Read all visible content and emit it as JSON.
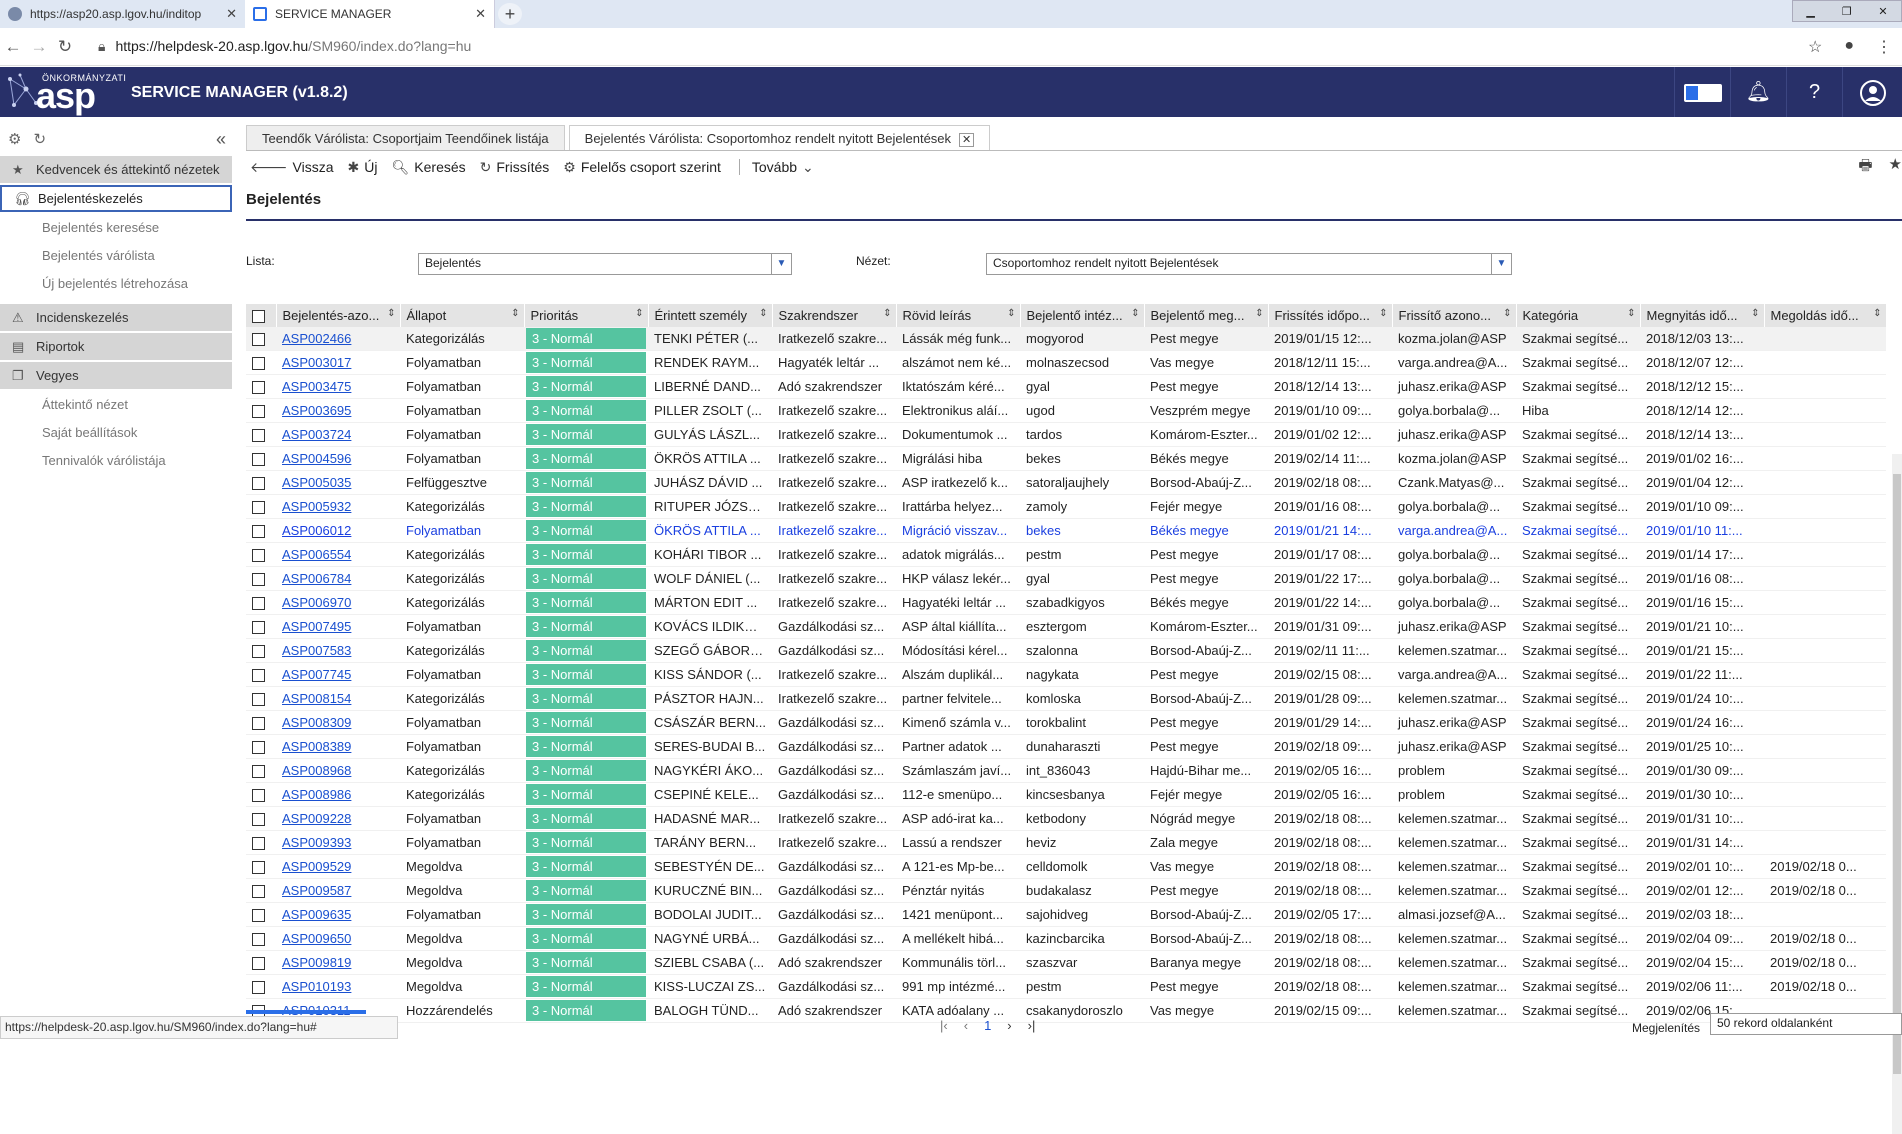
{
  "browser": {
    "tabs": [
      {
        "label": "https://asp20.asp.lgov.hu/inditop"
      },
      {
        "label": "SERVICE MANAGER"
      }
    ],
    "url_host": "https://helpdesk-20.asp.lgov.hu",
    "url_path": "/SM960/index.do?lang=hu"
  },
  "header": {
    "logo_small": "ÖNKORMÁNYZATI",
    "logo_big": "asp",
    "title": "SERVICE MANAGER (v1.8.2)"
  },
  "sidebar": {
    "sections": [
      {
        "label": "Kedvencek és áttekintő nézetek",
        "icon": "star-icon",
        "items": []
      },
      {
        "label": "Bejelentéskezelés",
        "icon": "headset-icon",
        "active": true,
        "items": [
          "Bejelentés keresése",
          "Bejelentés várólista",
          "Új bejelentés létrehozása"
        ]
      },
      {
        "label": "Incidenskezelés",
        "icon": "warning-icon",
        "items": []
      },
      {
        "label": "Riportok",
        "icon": "report-icon",
        "items": []
      },
      {
        "label": "Vegyes",
        "icon": "copy-icon",
        "items": [
          "Áttekintő nézet",
          "Saját beállítások",
          "Tennivalók várólistája"
        ]
      }
    ]
  },
  "content_tabs": [
    {
      "label": "Teendők Várólista: Csoportjaim Teendőinek listája"
    },
    {
      "label": "Bejelentés Várólista: Csoportomhoz rendelt nyitott Bejelentések"
    }
  ],
  "toolbar": {
    "back": "Vissza",
    "new": "Új",
    "search": "Keresés",
    "refresh": "Frissítés",
    "group_by": "Felelős csoport szerint",
    "more": "Tovább"
  },
  "page_title": "Bejelentés",
  "filters": {
    "list_label": "Lista:",
    "list_value": "Bejelentés",
    "view_label": "Nézet:",
    "view_value": "Csoportomhoz rendelt nyitott Bejelentések"
  },
  "table": {
    "columns": [
      "Bejelentés-azo...",
      "Állapot",
      "Prioritás",
      "Érintett személy",
      "Szakrendszer",
      "Rövid leírás",
      "Bejelentő intéz...",
      "Bejelentő meg...",
      "Frissítés időpo...",
      "Frissítő azono...",
      "Kategória",
      "Megnyitás idő...",
      "Megoldás idő..."
    ],
    "rows": [
      [
        "ASP002466",
        "Kategorizálás",
        "3 - Normál",
        "TENKI PÉTER (...",
        "Iratkezelő szakre...",
        "Lássák még funk...",
        "mogyorod",
        "Pest megye",
        "2019/01/15 12:...",
        "kozma.jolan@ASP",
        "Szakmai segítsé...",
        "2018/12/03 13:...",
        ""
      ],
      [
        "ASP003017",
        "Folyamatban",
        "3 - Normál",
        "RENDEK RAYM...",
        "Hagyaték leltár ...",
        "alszámot nem ké...",
        "molnaszecsod",
        "Vas megye",
        "2018/12/11 15:...",
        "varga.andrea@A...",
        "Szakmai segítsé...",
        "2018/12/07 12:...",
        ""
      ],
      [
        "ASP003475",
        "Folyamatban",
        "3 - Normál",
        "LIBERNÉ DAND...",
        "Adó szakrendszer",
        "Iktatószám kéré...",
        "gyal",
        "Pest megye",
        "2018/12/14 13:...",
        "juhasz.erika@ASP",
        "Szakmai segítsé...",
        "2018/12/12 15:...",
        ""
      ],
      [
        "ASP003695",
        "Folyamatban",
        "3 - Normál",
        "PILLER ZSOLT (...",
        "Iratkezelő szakre...",
        "Elektronikus aláí...",
        "ugod",
        "Veszprém megye",
        "2019/01/10 09:...",
        "golya.borbala@...",
        "Hiba",
        "2018/12/14 12:...",
        ""
      ],
      [
        "ASP003724",
        "Folyamatban",
        "3 - Normál",
        "GULYÁS LÁSZL...",
        "Iratkezelő szakre...",
        "Dokumentumok ...",
        "tardos",
        "Komárom-Eszter...",
        "2019/01/02 12:...",
        "juhasz.erika@ASP",
        "Szakmai segítsé...",
        "2018/12/14 13:...",
        ""
      ],
      [
        "ASP004596",
        "Folyamatban",
        "3 - Normál",
        "ÖKRÖS ATTILA ...",
        "Iratkezelő szakre...",
        "Migrálási hiba",
        "bekes",
        "Békés megye",
        "2019/02/14 11:...",
        "kozma.jolan@ASP",
        "Szakmai segítsé...",
        "2019/01/02 16:...",
        ""
      ],
      [
        "ASP005035",
        "Felfüggesztve",
        "3 - Normál",
        "JUHÁSZ DÁVID ...",
        "Iratkezelő szakre...",
        "ASP iratkezelő k...",
        "satoraljaujhely",
        "Borsod-Abaúj-Z...",
        "2019/02/18 08:...",
        "Czank.Matyas@...",
        "Szakmai segítsé...",
        "2019/01/04 12:...",
        ""
      ],
      [
        "ASP005932",
        "Kategorizálás",
        "3 - Normál",
        "RITUPER JÓZSE...",
        "Iratkezelő szakre...",
        "Irattárba helyez...",
        "zamoly",
        "Fejér megye",
        "2019/01/16 08:...",
        "golya.borbala@...",
        "Szakmai segítsé...",
        "2019/01/10 09:...",
        ""
      ],
      [
        "ASP006012",
        "Folyamatban",
        "3 - Normál",
        "ÖKRÖS ATTILA ...",
        "Iratkezelő szakre...",
        "Migráció visszav...",
        "bekes",
        "Békés megye",
        "2019/01/21 14:...",
        "varga.andrea@A...",
        "Szakmai segítsé...",
        "2019/01/10 11:...",
        ""
      ],
      [
        "ASP006554",
        "Kategorizálás",
        "3 - Normál",
        "KOHÁRI TIBOR ...",
        "Iratkezelő szakre...",
        "adatok migrálás...",
        "pestm",
        "Pest megye",
        "2019/01/17 08:...",
        "golya.borbala@...",
        "Szakmai segítsé...",
        "2019/01/14 17:...",
        ""
      ],
      [
        "ASP006784",
        "Kategorizálás",
        "3 - Normál",
        "WOLF DÁNIEL (...",
        "Iratkezelő szakre...",
        "HKP válasz lekér...",
        "gyal",
        "Pest megye",
        "2019/01/22 17:...",
        "golya.borbala@...",
        "Szakmai segítsé...",
        "2019/01/16 08:...",
        ""
      ],
      [
        "ASP006970",
        "Kategorizálás",
        "3 - Normál",
        "MÁRTON EDIT ...",
        "Iratkezelő szakre...",
        "Hagyatéki leltár ...",
        "szabadkigyos",
        "Békés megye",
        "2019/01/22 14:...",
        "golya.borbala@...",
        "Szakmai segítsé...",
        "2019/01/16 15:...",
        ""
      ],
      [
        "ASP007495",
        "Folyamatban",
        "3 - Normál",
        "KOVÁCS ILDIKÓ ...",
        "Gazdálkodási sz...",
        "ASP által kiállíta...",
        "esztergom",
        "Komárom-Eszter...",
        "2019/01/31 09:...",
        "juhasz.erika@ASP",
        "Szakmai segítsé...",
        "2019/01/21 10:...",
        ""
      ],
      [
        "ASP007583",
        "Kategorizálás",
        "3 - Normál",
        "SZEGŐ GÁBOR (...",
        "Gazdálkodási sz...",
        "Módosítási kérel...",
        "szalonna",
        "Borsod-Abaúj-Z...",
        "2019/02/11 11:...",
        "kelemen.szatmar...",
        "Szakmai segítsé...",
        "2019/01/21 15:...",
        ""
      ],
      [
        "ASP007745",
        "Folyamatban",
        "3 - Normál",
        "KISS SÁNDOR (...",
        "Iratkezelő szakre...",
        "Alszám duplikál...",
        "nagykata",
        "Pest megye",
        "2019/02/15 08:...",
        "varga.andrea@A...",
        "Szakmai segítsé...",
        "2019/01/22 11:...",
        ""
      ],
      [
        "ASP008154",
        "Kategorizálás",
        "3 - Normál",
        "PÁSZTOR HAJN...",
        "Iratkezelő szakre...",
        "partner felvitele...",
        "komloska",
        "Borsod-Abaúj-Z...",
        "2019/01/28 09:...",
        "kelemen.szatmar...",
        "Szakmai segítsé...",
        "2019/01/24 10:...",
        ""
      ],
      [
        "ASP008309",
        "Folyamatban",
        "3 - Normál",
        "CSÁSZÁR BERN...",
        "Gazdálkodási sz...",
        "Kimenő számla v...",
        "torokbalint",
        "Pest megye",
        "2019/01/29 14:...",
        "juhasz.erika@ASP",
        "Szakmai segítsé...",
        "2019/01/24 16:...",
        ""
      ],
      [
        "ASP008389",
        "Folyamatban",
        "3 - Normál",
        "SERES-BUDAI B...",
        "Gazdálkodási sz...",
        "Partner adatok ...",
        "dunaharaszti",
        "Pest megye",
        "2019/02/18 09:...",
        "juhasz.erika@ASP",
        "Szakmai segítsé...",
        "2019/01/25 10:...",
        ""
      ],
      [
        "ASP008968",
        "Kategorizálás",
        "3 - Normál",
        "NAGYKÉRI ÁKO...",
        "Gazdálkodási sz...",
        "Számlaszám javí...",
        "int_836043",
        "Hajdú-Bihar me...",
        "2019/02/05 16:...",
        "problem",
        "Szakmai segítsé...",
        "2019/01/30 09:...",
        ""
      ],
      [
        "ASP008986",
        "Kategorizálás",
        "3 - Normál",
        "CSEPINÉ KELE...",
        "Gazdálkodási sz...",
        "112-e smenüpo...",
        "kincsesbanya",
        "Fejér megye",
        "2019/02/05 16:...",
        "problem",
        "Szakmai segítsé...",
        "2019/01/30 10:...",
        ""
      ],
      [
        "ASP009228",
        "Folyamatban",
        "3 - Normál",
        "HADASNÉ MAR...",
        "Iratkezelő szakre...",
        "ASP adó-irat ka...",
        "ketbodony",
        "Nógrád megye",
        "2019/02/18 08:...",
        "kelemen.szatmar...",
        "Szakmai segítsé...",
        "2019/01/31 10:...",
        ""
      ],
      [
        "ASP009393",
        "Folyamatban",
        "3 - Normál",
        "TARÁNY BERN...",
        "Iratkezelő szakre...",
        "Lassú a rendszer",
        "heviz",
        "Zala megye",
        "2019/02/18 08:...",
        "kelemen.szatmar...",
        "Szakmai segítsé...",
        "2019/01/31 14:...",
        ""
      ],
      [
        "ASP009529",
        "Megoldva",
        "3 - Normál",
        "SEBESTYÉN DE...",
        "Gazdálkodási sz...",
        "A 121-es Mp-be...",
        "celldomolk",
        "Vas megye",
        "2019/02/18 08:...",
        "kelemen.szatmar...",
        "Szakmai segítsé...",
        "2019/02/01 10:...",
        "2019/02/18 0..."
      ],
      [
        "ASP009587",
        "Megoldva",
        "3 - Normál",
        "KURUCZNÉ BIN...",
        "Gazdálkodási sz...",
        "Pénztár nyitás",
        "budakalasz",
        "Pest megye",
        "2019/02/18 08:...",
        "kelemen.szatmar...",
        "Szakmai segítsé...",
        "2019/02/01 12:...",
        "2019/02/18 0..."
      ],
      [
        "ASP009635",
        "Folyamatban",
        "3 - Normál",
        "BODOLAI JUDIT...",
        "Gazdálkodási sz...",
        "1421 menüpont...",
        "sajohidveg",
        "Borsod-Abaúj-Z...",
        "2019/02/05 17:...",
        "almasi.jozsef@A...",
        "Szakmai segítsé...",
        "2019/02/03 18:...",
        ""
      ],
      [
        "ASP009650",
        "Megoldva",
        "3 - Normál",
        "NAGYNÉ URBÁ...",
        "Gazdálkodási sz...",
        "A mellékelt hibá...",
        "kazincbarcika",
        "Borsod-Abaúj-Z...",
        "2019/02/18 08:...",
        "kelemen.szatmar...",
        "Szakmai segítsé...",
        "2019/02/04 09:...",
        "2019/02/18 0..."
      ],
      [
        "ASP009819",
        "Megoldva",
        "3 - Normál",
        "SZIEBL CSABA (...",
        "Adó szakrendszer",
        "Kommunális törl...",
        "szaszvar",
        "Baranya megye",
        "2019/02/18 08:...",
        "kelemen.szatmar...",
        "Szakmai segítsé...",
        "2019/02/04 15:...",
        "2019/02/18 0..."
      ],
      [
        "ASP010193",
        "Megoldva",
        "3 - Normál",
        "KISS-LUCZAI ZS...",
        "Gazdálkodási sz...",
        "991 mp intézmé...",
        "pestm",
        "Pest megye",
        "2019/02/18 08:...",
        "kelemen.szatmar...",
        "Szakmai segítsé...",
        "2019/02/06 11:...",
        "2019/02/18 0..."
      ],
      [
        "ASP010311",
        "Hozzárendelés",
        "3 - Normál",
        "BALOGH TÜND...",
        "Adó szakrendszer",
        "KATA adóalany ...",
        "csakanydoroszlo",
        "Vas megye",
        "2019/02/15 09:...",
        "kelemen.szatmar...",
        "Szakmai segítsé...",
        "2019/02/06 15:...",
        ""
      ]
    ],
    "selected_row_index": 8
  },
  "footer": {
    "status_url": "https://helpdesk-20.asp.lgov.hu/SM960/index.do?lang=hu#",
    "page": "1",
    "show_label": "Megjelenítés",
    "show_value": "50 rekord oldalanként"
  },
  "colors": {
    "header_bg": "#283069",
    "priority_bg": "#55c4a0",
    "link": "#1a50d0",
    "selected_text": "#1a3fe0"
  }
}
